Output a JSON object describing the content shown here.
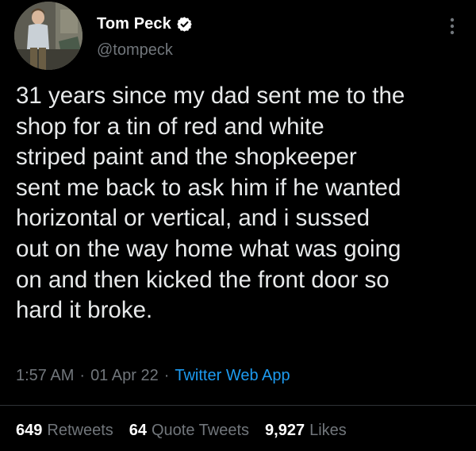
{
  "author": {
    "display_name": "Tom Peck",
    "handle": "@tompeck",
    "verified": true
  },
  "tweet": {
    "lines": [
      "31 years since my dad sent me to the",
      "shop for a tin of red and white",
      "striped paint and the shopkeeper",
      "sent me back to ask him if he wanted",
      "horizontal or vertical, and i sussed",
      "out on the way home what was going",
      "on and then kicked the front door so",
      "hard it broke."
    ],
    "time": "1:57 AM",
    "date": "01 Apr 22",
    "source": "Twitter Web App",
    "separator": "·"
  },
  "stats": {
    "retweets": {
      "count": "649",
      "label": "Retweets"
    },
    "quotes": {
      "count": "64",
      "label": "Quote Tweets"
    },
    "likes": {
      "count": "9,927",
      "label": "Likes"
    }
  },
  "colors": {
    "background": "#000000",
    "text": "#e7e9ea",
    "muted": "#71767b",
    "accent": "#1d9bf0"
  },
  "icons": {
    "verified": "verified-badge-icon",
    "more": "more-options-icon"
  }
}
